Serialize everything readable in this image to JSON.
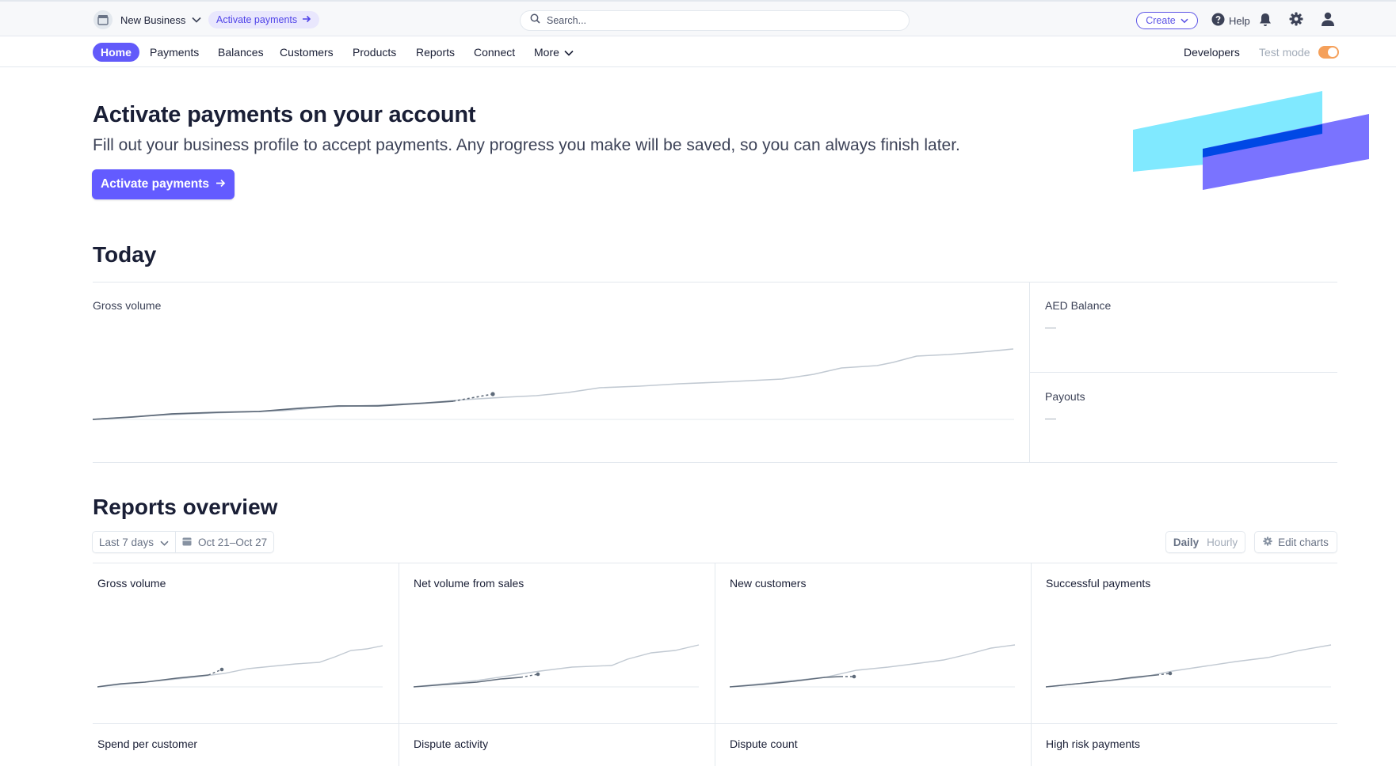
{
  "topbar": {
    "account_name": "New Business",
    "activate_pill": "Activate payments",
    "search_placeholder": "Search...",
    "create_label": "Create",
    "help_label": "Help",
    "icons": [
      "store-icon",
      "chevron-down-icon",
      "arrow-right-icon",
      "search-icon",
      "help-icon",
      "bell-icon",
      "gear-icon",
      "user-icon"
    ]
  },
  "nav": {
    "items": [
      "Home",
      "Payments",
      "Balances",
      "Customers",
      "Products",
      "Reports",
      "Connect",
      "More"
    ],
    "active": "Home",
    "developers": "Developers",
    "test_mode": "Test mode",
    "test_mode_on": true
  },
  "banner": {
    "title": "Activate payments on your account",
    "subtitle": "Fill out your business profile to accept payments. Any progress you make will be saved, so you can always finish later.",
    "button": "Activate payments"
  },
  "today": {
    "heading": "Today",
    "gross_volume_label": "Gross volume",
    "balance_label": "AED Balance",
    "balance_value": "—",
    "payouts_label": "Payouts",
    "payouts_value": "—"
  },
  "reports": {
    "heading": "Reports overview",
    "range_label": "Last 7 days",
    "date_range": "Oct 21–Oct 27",
    "granularity": [
      "Daily",
      "Hourly"
    ],
    "granularity_selected": "Daily",
    "edit_charts": "Edit charts",
    "cards": [
      "Gross volume",
      "Net volume from sales",
      "New customers",
      "Successful payments",
      "Spend per customer",
      "Dispute activity",
      "Dispute count",
      "High risk payments"
    ]
  },
  "colors": {
    "accent": "#635bff",
    "primary_text": "#1a1f36",
    "line_current": "#5f6b7a",
    "line_previous": "#c1c9d2"
  }
}
